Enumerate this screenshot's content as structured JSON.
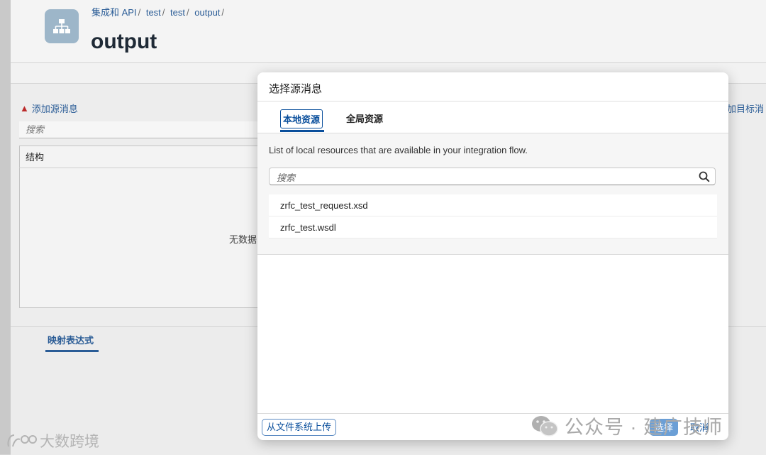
{
  "breadcrumb": {
    "items": [
      "集成和 API",
      "test",
      "test",
      "output"
    ],
    "separator": "/"
  },
  "page": {
    "title": "output"
  },
  "background": {
    "add_source_label": "添加源消息",
    "add_target_label": "加目标消",
    "search_placeholder": "搜索",
    "structure_header": "结构",
    "no_data_label": "无数据",
    "mapping_tab_label": "映射表达式"
  },
  "dialog": {
    "title": "选择源消息",
    "tabs": [
      {
        "label": "本地资源",
        "active": true
      },
      {
        "label": "全局资源",
        "active": false
      }
    ],
    "description": "List of local resources that are available in your integration flow.",
    "search_placeholder": "搜索",
    "resources": [
      "zrfc_test_request.xsd",
      "zrfc_test.wsdl"
    ],
    "upload_label": "从文件系统上传",
    "ok_label": "选择",
    "cancel_label": "取消"
  },
  "watermarks": {
    "right": "公众号 · 建广技师",
    "left": "大数跨境"
  },
  "colors": {
    "accent": "#0a4f9c",
    "link": "#2a5c96",
    "highlight_box": "#d6262a",
    "warning": "#bb2a2a"
  }
}
